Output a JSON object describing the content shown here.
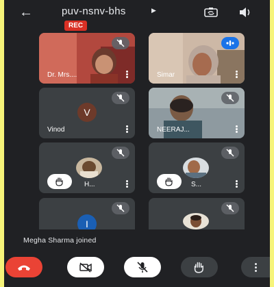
{
  "header": {
    "meeting_code": "puv-nsnv-bhs",
    "rec_label": "REC",
    "icons": [
      "arrow-back-icon",
      "play-triangle-icon",
      "switch-camera-icon",
      "speaker-icon"
    ]
  },
  "participants": [
    {
      "name": "Dr. Mrs....",
      "state": "muted",
      "view": "video"
    },
    {
      "name": "Simar",
      "state": "speaking",
      "view": "video"
    },
    {
      "name": "Vinod",
      "state": "muted",
      "view": "avatar",
      "avatar_letter": "V",
      "avatar_color": "#6d3a2a"
    },
    {
      "name": "NEERAJ...",
      "state": "muted",
      "view": "video"
    },
    {
      "name": "H...",
      "state": "muted",
      "view": "photo",
      "hand_raised": true
    },
    {
      "name": "S...",
      "state": "muted",
      "view": "photo",
      "hand_raised": true
    },
    {
      "name": "",
      "state": "muted",
      "view": "avatar",
      "avatar_letter": "I",
      "avatar_color": "#1a5fb4"
    },
    {
      "name": "",
      "state": "muted",
      "view": "photo"
    }
  ],
  "notification": "Megha Sharma joined",
  "controls": [
    {
      "name": "end-call-button",
      "icon": "phone-hangup-icon",
      "color": "#ea4335"
    },
    {
      "name": "camera-toggle-button",
      "icon": "video-off-icon",
      "color": "#ffffff"
    },
    {
      "name": "mic-toggle-button",
      "icon": "mic-off-icon",
      "color": "#ffffff"
    },
    {
      "name": "raise-hand-button",
      "icon": "hand-icon",
      "color": "#3c4043"
    },
    {
      "name": "more-options-button",
      "icon": "more-vert-icon",
      "color": "#3c4043"
    }
  ],
  "colors": {
    "page_border": "#f6f47a",
    "app_bg": "#202124",
    "tile_bg": "#3c4043",
    "rec": "#d93025",
    "speaking": "#1a73e8"
  }
}
